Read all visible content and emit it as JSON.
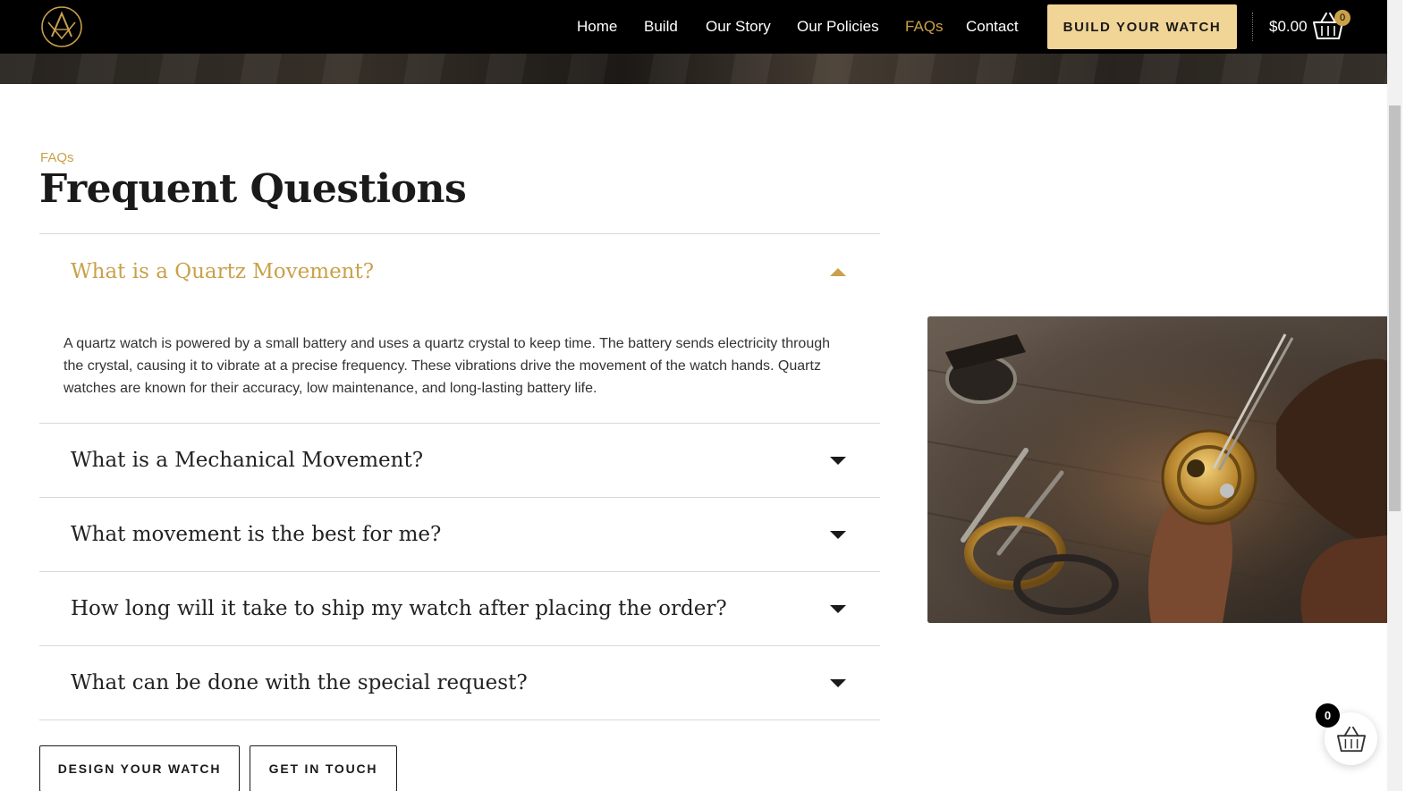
{
  "header": {
    "nav": [
      "Home",
      "Build",
      "Our Story",
      "Our Policies",
      "FAQs",
      "Contact"
    ],
    "active_nav": "FAQs",
    "build_button": "BUILD YOUR WATCH",
    "cart_amount": "$0.00",
    "cart_count": "0"
  },
  "main": {
    "eyebrow": "FAQs",
    "title": "Frequent Questions",
    "faqs": [
      {
        "question": "What is a Quartz Movement?",
        "answer": "A quartz watch is powered by a small battery and uses a quartz crystal to keep time. The battery sends electricity through the crystal, causing it to vibrate at a precise frequency. These vibrations drive the movement of the watch hands. Quartz watches are known for their accuracy, low maintenance, and long-lasting battery life.",
        "open": true
      },
      {
        "question": "What is a Mechanical Movement?",
        "open": false
      },
      {
        "question": "What movement is the best for me?",
        "open": false
      },
      {
        "question": "How long will it take to ship my watch after placing the order?",
        "open": false
      },
      {
        "question": "What can be done with the special request?",
        "open": false
      }
    ],
    "buttons": {
      "design": "DESIGN YOUR WATCH",
      "contact": "GET IN TOUCH"
    }
  },
  "floating_cart": {
    "count": "0"
  },
  "colors": {
    "accent": "#c9a14a",
    "button_gold": "#f1d596",
    "header_bg": "#000000"
  },
  "icons": [
    "brand-logo",
    "basket-icon",
    "caret-up-icon",
    "caret-down-icon"
  ]
}
